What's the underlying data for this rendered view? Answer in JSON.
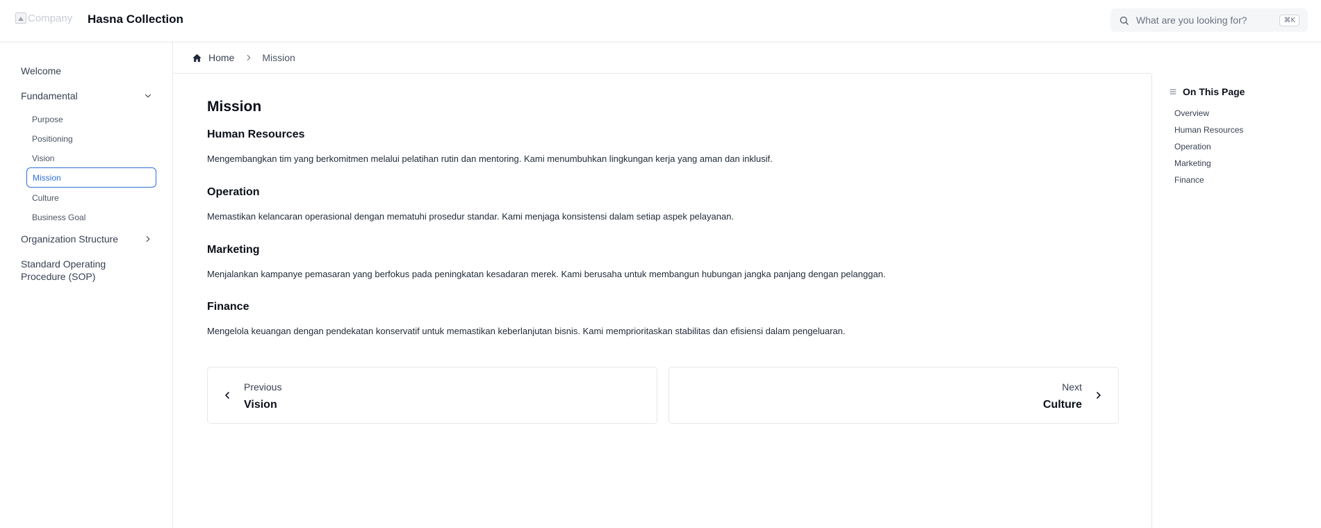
{
  "header": {
    "logo_alt": "Company",
    "site_title": "Hasna Collection",
    "search": {
      "placeholder": "What are you looking for?",
      "shortcut": "⌘K"
    }
  },
  "sidebar": {
    "welcome": "Welcome",
    "fundamental": {
      "label": "Fundamental",
      "expanded": true,
      "items": [
        "Purpose",
        "Positioning",
        "Vision",
        "Mission",
        "Culture",
        "Business Goal"
      ],
      "active": "Mission"
    },
    "organization_structure": "Organization Structure",
    "sop": {
      "line1": "Standard Operating",
      "line2": "Procedure (SOP)"
    }
  },
  "breadcrumb": {
    "home": "Home",
    "current": "Mission"
  },
  "main": {
    "title": "Mission",
    "sections": [
      {
        "heading": "Human Resources",
        "text": "Mengembangkan tim yang berkomitmen melalui pelatihan rutin dan mentoring. Kami menumbuhkan lingkungan kerja yang aman dan inklusif."
      },
      {
        "heading": "Operation",
        "text": "Memastikan kelancaran operasional dengan mematuhi prosedur standar. Kami menjaga konsistensi dalam setiap aspek pelayanan."
      },
      {
        "heading": "Marketing",
        "text": "Menjalankan kampanye pemasaran yang berfokus pada peningkatan kesadaran merek. Kami berusaha untuk membangun hubungan jangka panjang dengan pelanggan."
      },
      {
        "heading": "Finance",
        "text": "Mengelola keuangan dengan pendekatan konservatif untuk memastikan keberlanjutan bisnis. Kami memprioritaskan stabilitas dan efisiensi dalam pengeluaran."
      }
    ],
    "pager": {
      "prev": {
        "label": "Previous",
        "title": "Vision"
      },
      "next": {
        "label": "Next",
        "title": "Culture"
      }
    }
  },
  "toc": {
    "heading": "On This Page",
    "items": [
      "Overview",
      "Human Resources",
      "Operation",
      "Marketing",
      "Finance"
    ]
  },
  "colors": {
    "accent": "#2f6fd6",
    "border": "#e5e7eb",
    "text": "#0b0f19"
  }
}
